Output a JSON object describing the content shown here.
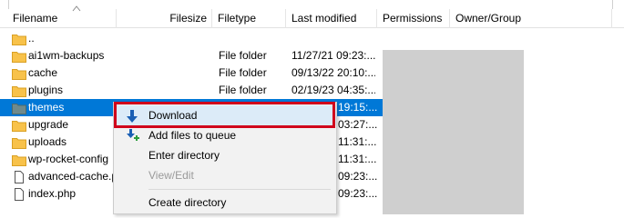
{
  "colors": {
    "selection": "#0078d7",
    "highlight_border": "#d0021b",
    "folder": "#f8c24a",
    "redacted": "#cfcfcf"
  },
  "columns": {
    "filename": "Filename",
    "filesize": "Filesize",
    "filetype": "Filetype",
    "last_modified": "Last modified",
    "permissions": "Permissions",
    "owner_group": "Owner/Group"
  },
  "files": [
    {
      "name": "..",
      "type": "",
      "modified": "",
      "icon": "folder-icon"
    },
    {
      "name": "ai1wm-backups",
      "type": "File folder",
      "modified": "11/27/21 09:23:...",
      "icon": "folder-icon"
    },
    {
      "name": "cache",
      "type": "File folder",
      "modified": "09/13/22 20:10:...",
      "icon": "folder-icon"
    },
    {
      "name": "plugins",
      "type": "File folder",
      "modified": "02/19/23 04:35:...",
      "icon": "folder-icon"
    },
    {
      "name": "themes",
      "type": "",
      "modified": "19:15:...",
      "icon": "folder-icon",
      "selected": true
    },
    {
      "name": "upgrade",
      "type": "",
      "modified": "03:27:...",
      "icon": "folder-icon"
    },
    {
      "name": "uploads",
      "type": "",
      "modified": "11:31:...",
      "icon": "folder-icon"
    },
    {
      "name": "wp-rocket-config",
      "type": "",
      "modified": "11:31:...",
      "icon": "folder-icon"
    },
    {
      "name": "advanced-cache.p",
      "type": "",
      "modified": "09:23:...",
      "icon": "file-icon"
    },
    {
      "name": "index.php",
      "type": "",
      "modified": "09:23:...",
      "icon": "file-icon"
    }
  ],
  "context_menu": {
    "download": "Download",
    "add_to_queue": "Add files to queue",
    "enter_directory": "Enter directory",
    "view_edit": "View/Edit",
    "create_directory": "Create directory"
  }
}
